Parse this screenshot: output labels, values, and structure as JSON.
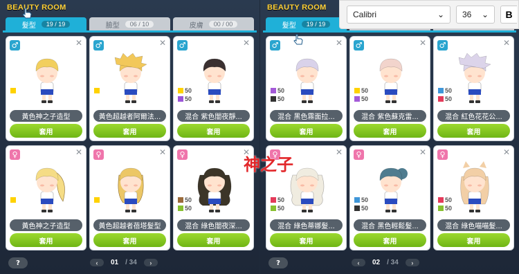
{
  "left": {
    "title": "BEAUTY ROOM",
    "tabs": [
      {
        "label": "髮型",
        "count": "19 / 19",
        "active": true
      },
      {
        "label": "臉型",
        "count": "06 / 10",
        "active": false
      },
      {
        "label": "皮膚",
        "count": "00 / 00",
        "active": false
      }
    ],
    "cards": [
      {
        "gender": "♂",
        "name": "黃色神之子造型",
        "hair": "#f2cf5e",
        "style": "short",
        "sw": [
          {
            "c": "#ffd200",
            "v": ""
          }
        ]
      },
      {
        "gender": "♂",
        "name": "黃色超越者阿爾法...",
        "hair": "#f2c85a",
        "style": "spiky",
        "sw": [
          {
            "c": "#ffd200",
            "v": ""
          }
        ]
      },
      {
        "gender": "♂",
        "name": "混合 紫色闇夜靜...",
        "hair": "#3a3030",
        "style": "dark",
        "sw": [
          {
            "c": "#ffd200",
            "v": "50"
          },
          {
            "c": "#9b55d8",
            "v": "50"
          }
        ]
      },
      {
        "gender": "♀",
        "name": "黃色神之子造型",
        "hair": "#f5dc85",
        "style": "pony",
        "sw": [
          {
            "c": "#ffd200",
            "v": ""
          }
        ]
      },
      {
        "gender": "♀",
        "name": "黃色超越者蓓塔髮型",
        "hair": "#ecc766",
        "style": "long",
        "sw": [
          {
            "c": "#ffd200",
            "v": ""
          }
        ]
      },
      {
        "gender": "♀",
        "name": "混合 綠色闇夜深...",
        "hair": "#3c3528",
        "style": "wavy",
        "sw": [
          {
            "c": "#9a6a3a",
            "v": "50"
          },
          {
            "c": "#88c030",
            "v": "50"
          }
        ]
      }
    ],
    "page": "01",
    "total": "/ 34",
    "help": "?",
    "apply": "套用"
  },
  "right": {
    "title": "BEAUTY ROOM",
    "tabs": [
      {
        "label": "髮型",
        "count": "19 / 19",
        "active": true
      },
      {
        "label": "臉型",
        "count": "",
        "active": false
      },
      {
        "label": "皮膚",
        "count": "",
        "active": false
      }
    ],
    "cards": [
      {
        "gender": "♂",
        "name": "混合 黑色霧面拉...",
        "hair": "#d9d2ea",
        "style": "short",
        "sw": [
          {
            "c": "#a45ad8",
            "v": "50"
          },
          {
            "c": "#333333",
            "v": "50"
          }
        ]
      },
      {
        "gender": "♂",
        "name": "混合 紫色蘇克雷...",
        "hair": "#f2d4cc",
        "style": "short",
        "sw": [
          {
            "c": "#ffd200",
            "v": "50"
          },
          {
            "c": "#a45ad8",
            "v": "50"
          }
        ]
      },
      {
        "gender": "♂",
        "name": "混合 紅色花花公...",
        "hair": "#dcd4ea",
        "style": "spiky",
        "sw": [
          {
            "c": "#3f96d8",
            "v": "50"
          },
          {
            "c": "#e43a5a",
            "v": "50"
          }
        ]
      },
      {
        "gender": "♀",
        "name": "混合 綠色蒂娜髮...",
        "hair": "#f0ece0",
        "style": "wavy",
        "sw": [
          {
            "c": "#e43a5a",
            "v": "50"
          },
          {
            "c": "#88c030",
            "v": "50"
          }
        ]
      },
      {
        "gender": "♀",
        "name": "混合 黑色輕鬆髮...",
        "hair": "#4f7c8f",
        "style": "bun",
        "sw": [
          {
            "c": "#3f96d8",
            "v": "50"
          },
          {
            "c": "#333333",
            "v": "50"
          }
        ]
      },
      {
        "gender": "♀",
        "name": "混合 綠色喵喵髮...",
        "hair": "#f2cfa6",
        "style": "cat",
        "sw": [
          {
            "c": "#e43a5a",
            "v": "50"
          },
          {
            "c": "#88c030",
            "v": "50"
          }
        ]
      }
    ],
    "page": "02",
    "total": "/ 34",
    "help": "?",
    "apply": "套用"
  },
  "toolbar": {
    "font": "Calibri",
    "size": "36",
    "bold": "B"
  },
  "overlay": "神之子"
}
